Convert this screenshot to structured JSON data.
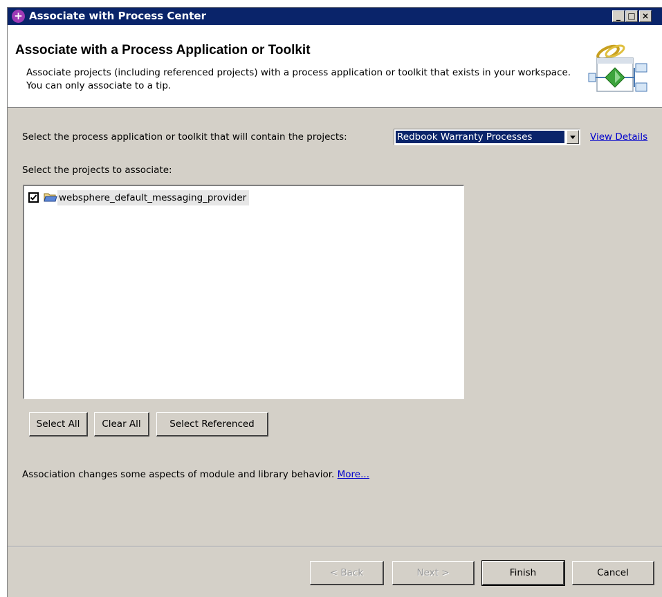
{
  "window": {
    "title": "Associate with Process Center",
    "minimize_glyph": "_",
    "maximize_glyph": "□",
    "close_glyph": "×"
  },
  "header": {
    "title": "Associate with a Process Application or Toolkit",
    "description": "Associate projects (including referenced projects) with a process application or toolkit that exists in your workspace. You can only associate to a tip.",
    "icon": "process-association-icon"
  },
  "form": {
    "select_label": "Select the process application or toolkit that will contain the projects:",
    "selected_value": "Redbook Warranty Processes",
    "view_details_link": "View Details",
    "projects_label": "Select the projects to associate:"
  },
  "projects": [
    {
      "name": "websphere_default_messaging_provider",
      "checked": true,
      "icon": "project-folder-icon"
    }
  ],
  "list_buttons": {
    "select_all": "Select All",
    "clear_all": "Clear All",
    "select_referenced": "Select Referenced"
  },
  "note": {
    "text": "Association changes some aspects of module and library behavior.",
    "more_link": "More..."
  },
  "wizard_buttons": {
    "back": "< Back",
    "next": "Next >",
    "finish": "Finish",
    "cancel": "Cancel"
  },
  "colors": {
    "titlebar": "#0a246a",
    "dialog_bg": "#d4d0c8",
    "selection": "#0a246a",
    "link": "#0000cc"
  }
}
